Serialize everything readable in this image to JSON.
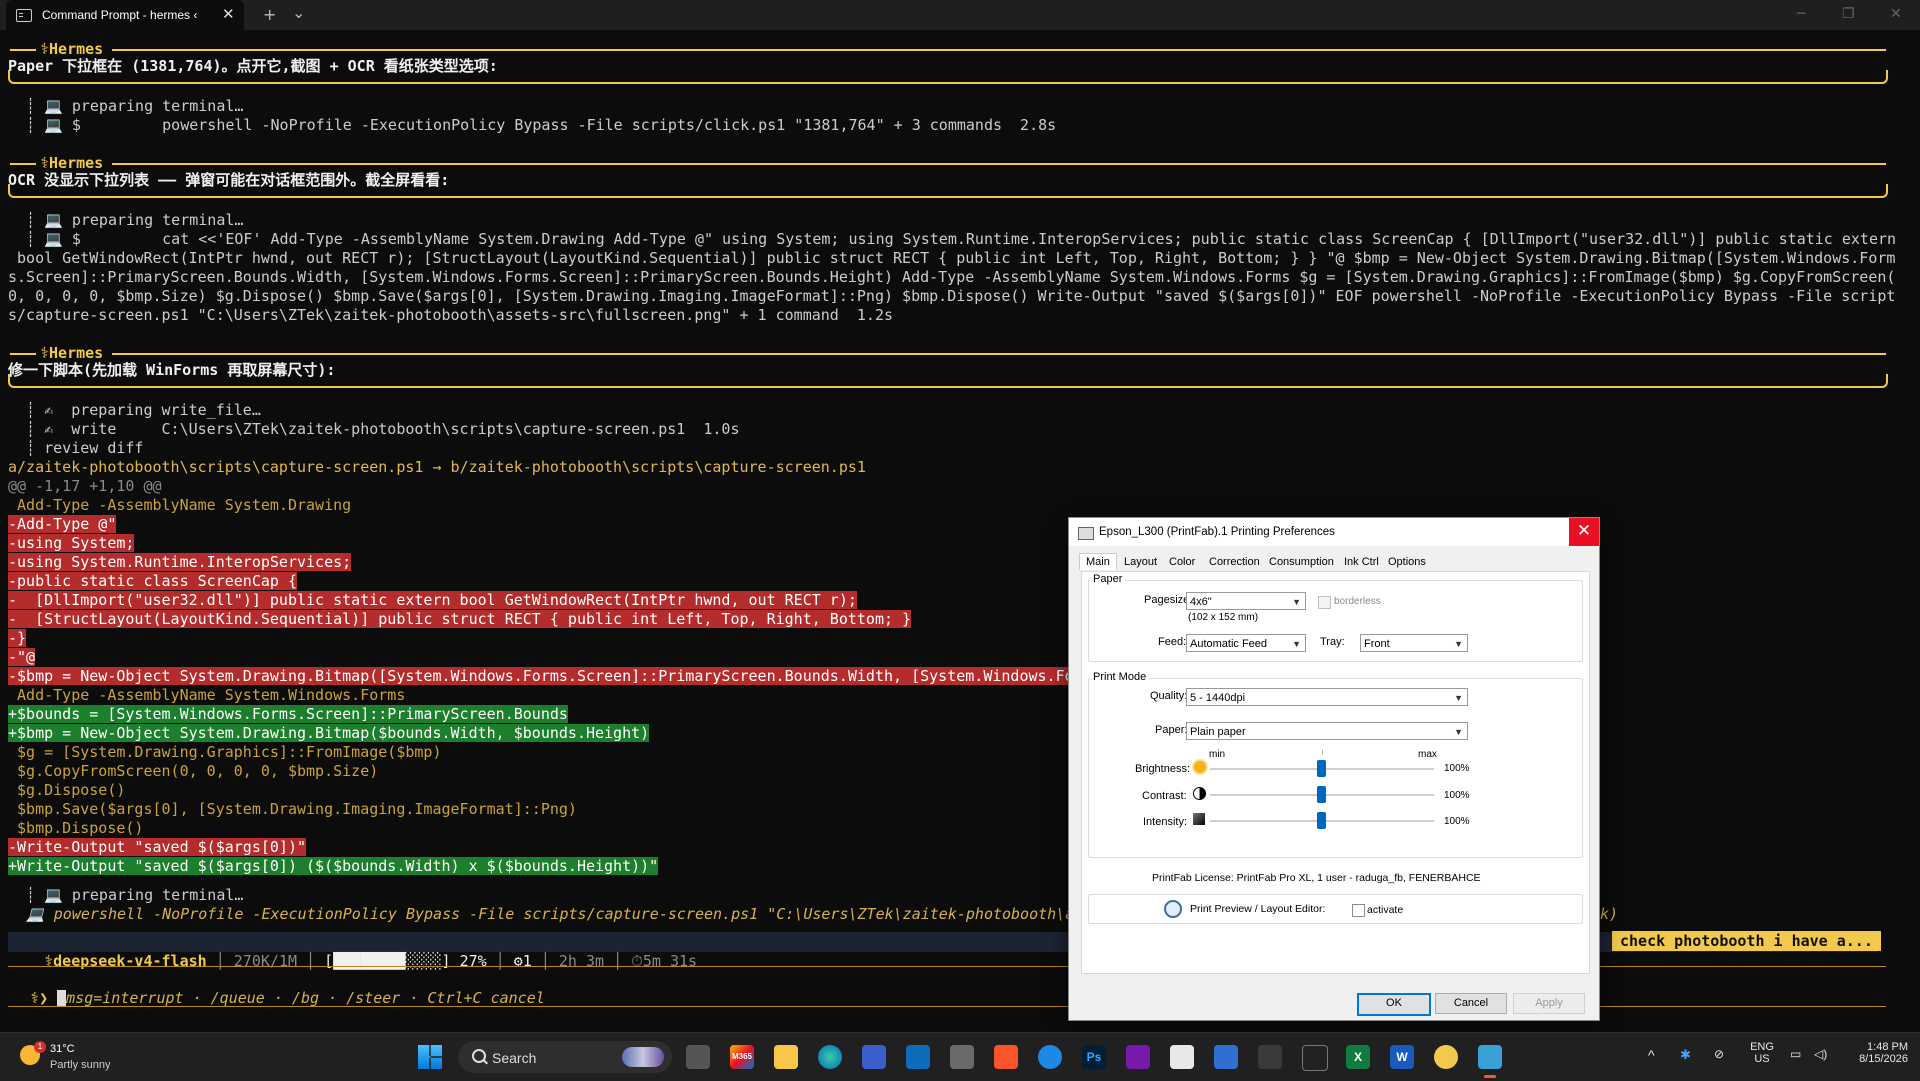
{
  "window": {
    "tab_title": "Command Prompt - hermes ‹",
    "new_tab": "+",
    "tab_menu": "⌄",
    "close_tab": "✕",
    "minimize": "─",
    "maximize": "❐",
    "close": "✕"
  },
  "terminal": {
    "hermes_label": "⚕Hermes",
    "block1": {
      "message": "Paper 下拉框在 (1381,764)。点开它,截图 + OCR 看纸张类型选项:",
      "line1": "  ┊ 💻 preparing terminal…",
      "line2": "  ┊ 💻 $         powershell -NoProfile -ExecutionPolicy Bypass -File scripts/click.ps1 \"1381,764\" + 3 commands  2.8s"
    },
    "block2": {
      "message": "OCR 没显示下拉列表 —— 弹窗可能在对话框范围外。截全屏看看:",
      "line1": "  ┊ 💻 preparing terminal…",
      "line2": "  ┊ 💻 $         cat <<'EOF' Add-Type -AssemblyName System.Drawing Add-Type @\" using System; using System.Runtime.InteropServices; public static class ScreenCap { [DllImport(\"user32.dll\")] public static extern",
      "line3": " bool GetWindowRect(IntPtr hwnd, out RECT r); [StructLayout(LayoutKind.Sequential)] public struct RECT { public int Left, Top, Right, Bottom; } } \"@ $bmp = New-Object System.Drawing.Bitmap([System.Windows.Form",
      "line4": "s.Screen]::PrimaryScreen.Bounds.Width, [System.Windows.Forms.Screen]::PrimaryScreen.Bounds.Height) Add-Type -AssemblyName System.Windows.Forms $g = [System.Drawing.Graphics]::FromImage($bmp) $g.CopyFromScreen(",
      "line5": "0, 0, 0, 0, $bmp.Size) $g.Dispose() $bmp.Save($args[0], [System.Drawing.Imaging.ImageFormat]::Png) $bmp.Dispose() Write-Output \"saved $($args[0])\" EOF powershell -NoProfile -ExecutionPolicy Bypass -File script",
      "line6": "s/capture-screen.ps1 \"C:\\Users\\ZTek\\zaitek-photobooth\\assets-src\\fullscreen.png\" + 1 command  1.2s"
    },
    "block3": {
      "message": "修一下脚本(先加载 WinForms 再取屏幕尺寸):",
      "line1": "  ┊ ✍  preparing write_file…",
      "line2": "  ┊ ✍  write     C:\\Users\\ZTek\\zaitek-photobooth\\scripts\\capture-screen.ps1  1.0s",
      "line3": "  ┊ review diff"
    },
    "diff": {
      "file": "a/zaitek-photobooth\\scripts\\capture-screen.ps1 → b/zaitek-photobooth\\scripts\\capture-screen.ps1",
      "hunk": "@@ -1,17 +1,10 @@",
      "lines": [
        {
          "t": "ctx",
          "text": " Add-Type -AssemblyName System.Drawing"
        },
        {
          "t": "del",
          "text": "-Add-Type @\""
        },
        {
          "t": "del",
          "text": "-using System;"
        },
        {
          "t": "del",
          "text": "-using System.Runtime.InteropServices;"
        },
        {
          "t": "del",
          "text": "-public static class ScreenCap {"
        },
        {
          "t": "del",
          "text": "-  [DllImport(\"user32.dll\")] public static extern bool GetWindowRect(IntPtr hwnd, out RECT r);"
        },
        {
          "t": "del",
          "text": "-  [StructLayout(LayoutKind.Sequential)] public struct RECT { public int Left, Top, Right, Bottom; }"
        },
        {
          "t": "del",
          "text": "-}"
        },
        {
          "t": "del",
          "text": "-\"@"
        },
        {
          "t": "del",
          "text": "-$bmp = New-Object System.Drawing.Bitmap([System.Windows.Forms.Screen]::PrimaryScreen.Bounds.Width, [System.Windows.Fo"
        },
        {
          "t": "ctx",
          "text": " Add-Type -AssemblyName System.Windows.Forms"
        },
        {
          "t": "add",
          "text": "+$bounds = [System.Windows.Forms.Screen]::PrimaryScreen.Bounds"
        },
        {
          "t": "add",
          "text": "+$bmp = New-Object System.Drawing.Bitmap($bounds.Width, $bounds.Height)"
        },
        {
          "t": "ctx",
          "text": " $g = [System.Drawing.Graphics]::FromImage($bmp)"
        },
        {
          "t": "ctx",
          "text": " $g.CopyFromScreen(0, 0, 0, 0, $bmp.Size)"
        },
        {
          "t": "ctx",
          "text": " $g.Dispose()"
        },
        {
          "t": "ctx",
          "text": " $bmp.Save($args[0], [System.Drawing.Imaging.ImageFormat]::Png)"
        },
        {
          "t": "ctx",
          "text": " $bmp.Dispose()"
        },
        {
          "t": "del",
          "text": "-Write-Output \"saved $($args[0])\""
        },
        {
          "t": "add",
          "text": "+Write-Output \"saved $($args[0]) ($($bounds.Width) x $($bounds.Height))\""
        }
      ]
    },
    "after_diff1": "  ┊ 💻 preparing terminal…",
    "after_diff2": "  💻 powershell -NoProfile -ExecutionPolicy Bypass -File scripts/capture-screen.ps1 \"C:\\Users\\ZTek\\zaitek-photobooth\\a",
    "after_diff2_tail": "k)",
    "status": {
      "model": "⚕deepseek-v4-flash",
      "tokens": "270K/1M",
      "bar": "[████████░░░░]",
      "percent": "27%",
      "agents": "⚙1",
      "session": "2h 3m",
      "timer": "⏱5m 31s",
      "task": "check photobooth i have a..."
    },
    "prompt": "⚕❯ ",
    "prompt_hint": "msg=interrupt · /queue · /bg · /steer · Ctrl+C cancel"
  },
  "dialog": {
    "title": "Epson_L300 (PrintFab).1 Printing Preferences",
    "tabs": [
      "Main",
      "Layout",
      "Color",
      "Correction",
      "Consumption",
      "Ink Ctrl",
      "Options"
    ],
    "paper_group": "Paper",
    "pagesize_label": "Pagesize:",
    "pagesize_value": "4x6\"",
    "pagesize_sub": "(102 x 152 mm)",
    "borderless_label": "borderless",
    "feed_label": "Feed:",
    "feed_value": "Automatic Feed",
    "tray_label": "Tray:",
    "tray_value": "Front",
    "printmode_group": "Print Mode",
    "quality_label": "Quality:",
    "quality_value": "5 - 1440dpi",
    "paper_label": "Paper:",
    "paper_value": "Plain paper",
    "min_label": "min",
    "max_label": "max",
    "brightness_label": "Brightness:",
    "brightness_value": "100%",
    "contrast_label": "Contrast:",
    "contrast_value": "100%",
    "intensity_label": "Intensity:",
    "intensity_value": "100%",
    "license": "PrintFab License: PrintFab Pro XL, 1 user - raduga_fb, FENERBAHCE",
    "preview_label": "Print Preview / Layout Editor:",
    "activate_label": "activate",
    "ok": "OK",
    "cancel": "Cancel",
    "apply": "Apply"
  },
  "taskbar": {
    "weather_temp": "31°C",
    "weather_desc": "Partly sunny",
    "weather_badge": "1",
    "search_placeholder": "Search",
    "lang1": "ENG",
    "lang2": "US",
    "time": "1:48 PM",
    "date": "8/15/2026",
    "apps": [
      "M365",
      "Ps",
      "X",
      "W"
    ]
  },
  "colors": {
    "accent_gold": "#f2c94c",
    "diff_delete": "#b42c2c",
    "diff_add": "#1b7f2b",
    "dialog_close": "#e81123",
    "win_accent": "#0078d7"
  }
}
